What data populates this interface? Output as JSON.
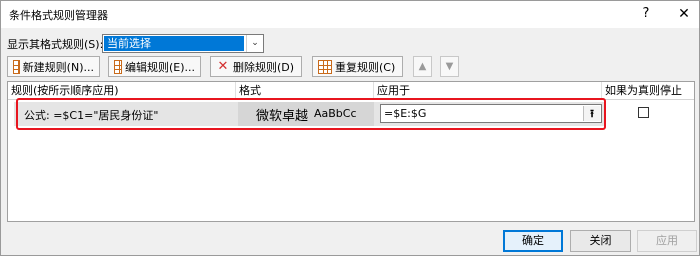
{
  "window": {
    "title": "条件格式规则管理器",
    "help_glyph": "?",
    "close_glyph": "✕"
  },
  "show_rules": {
    "label": "显示其格式规则(S):",
    "selected": "当前选择"
  },
  "toolbar": {
    "new_rule": "新建规则(N)...",
    "edit_rule": "编辑规则(E)...",
    "delete_rule": "删除规则(D)",
    "duplicate_rule": "重复规则(C)",
    "move_up_glyph": "▲",
    "move_down_glyph": "▼"
  },
  "grid": {
    "columns": [
      "规则(按所示顺序应用)",
      "格式",
      "应用于",
      "如果为真则停止"
    ],
    "rows": [
      {
        "rule": "公式: =$C1=\"居民身份证\"",
        "format_preview_cn": "微软卓越",
        "format_preview_en": "AaBbCc",
        "applies_to": "=$E:$G",
        "stop_if_true": false
      }
    ]
  },
  "buttons": {
    "ok": "确定",
    "close": "关闭",
    "apply": "应用"
  },
  "colors": {
    "accent": "#0078d7",
    "highlight_outline": "#e8151f"
  }
}
